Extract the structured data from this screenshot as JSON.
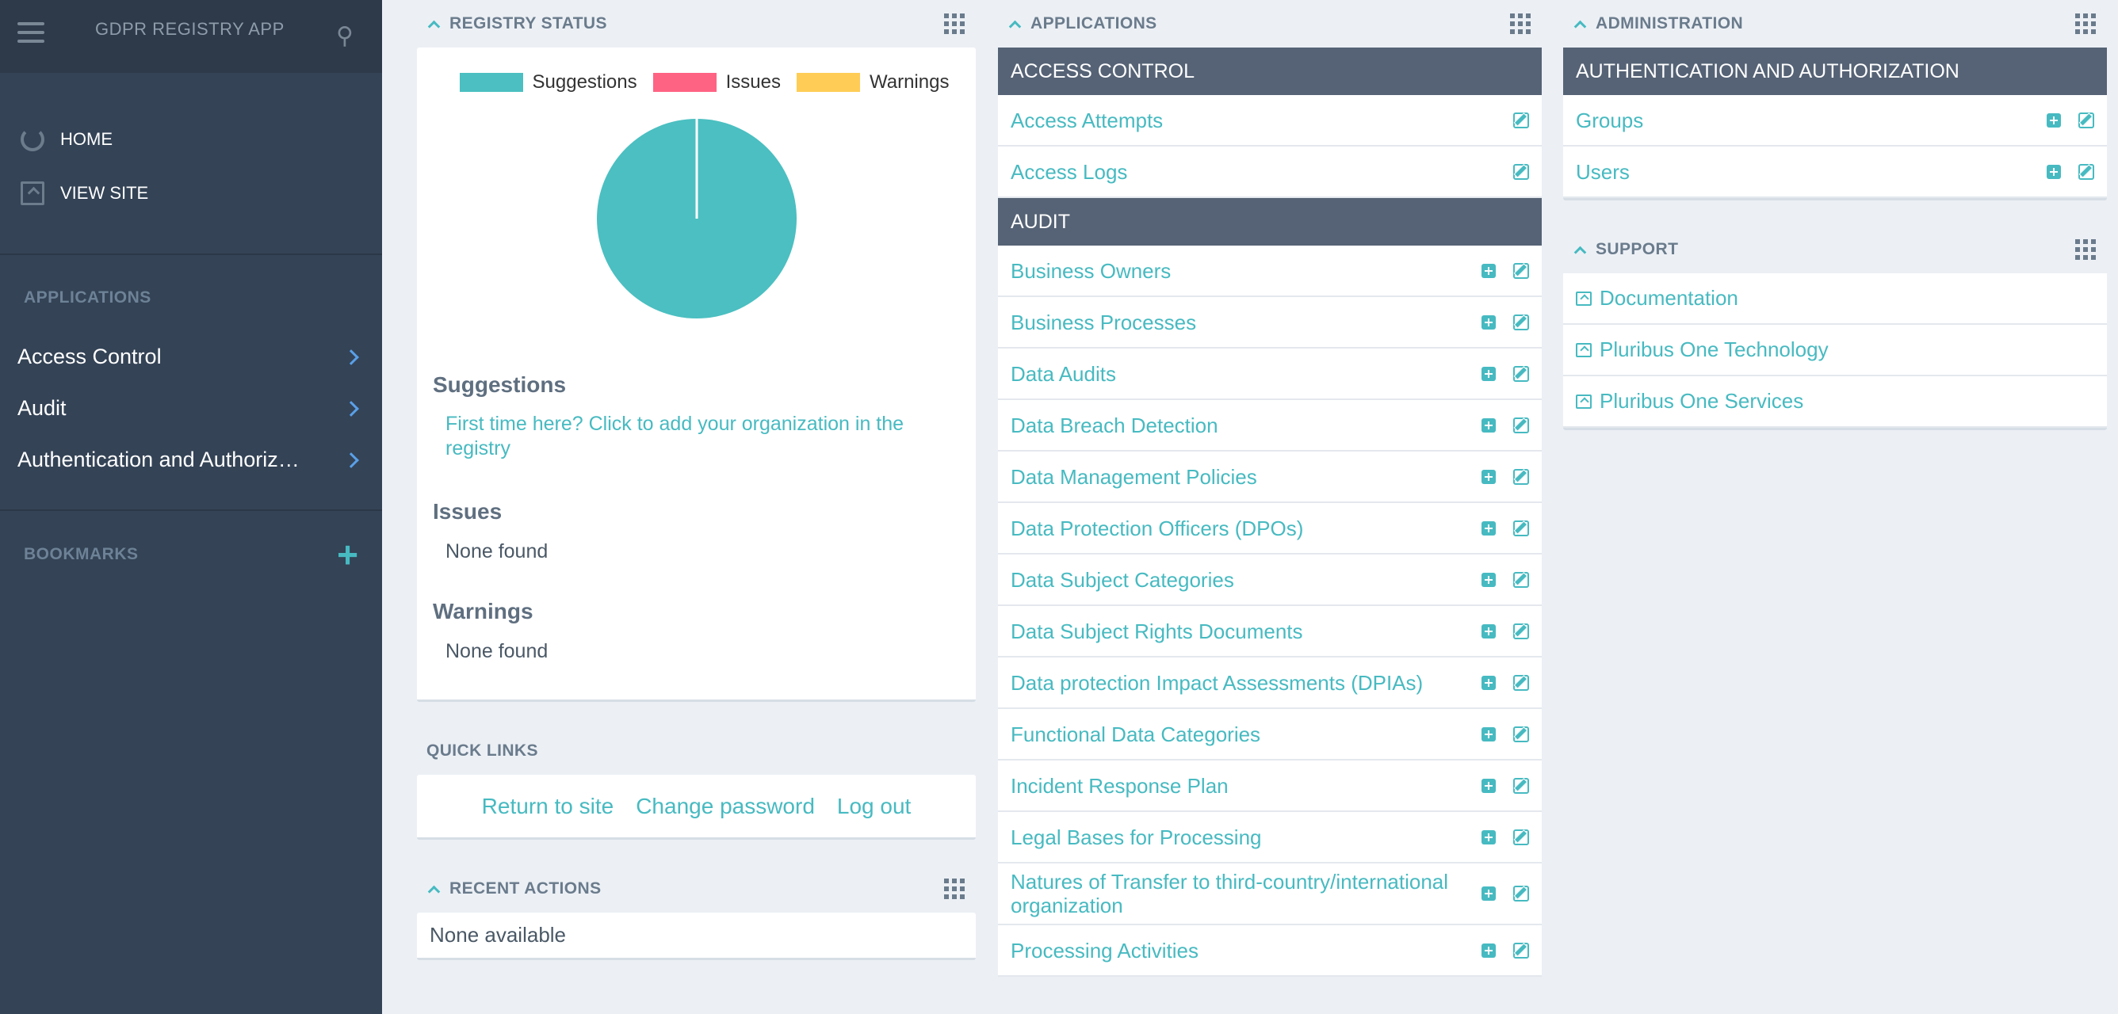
{
  "sidebar": {
    "title": "GDPR REGISTRY APP",
    "nav": [
      {
        "label": "HOME",
        "icon": "refresh-icon"
      },
      {
        "label": "VIEW SITE",
        "icon": "view-site-icon"
      }
    ],
    "applications_title": "APPLICATIONS",
    "apps": [
      "Access Control",
      "Audit",
      "Authentication and Authoriz…"
    ],
    "bookmarks_title": "BOOKMARKS"
  },
  "registry_status": {
    "title": "REGISTRY STATUS",
    "legend": [
      {
        "label": "Suggestions",
        "color": "#4bbfc1"
      },
      {
        "label": "Issues",
        "color": "#ff6384"
      },
      {
        "label": "Warnings",
        "color": "#ffcd56"
      }
    ],
    "suggestions_title": "Suggestions",
    "suggestion_link": "First time here? Click to add your organization in the registry",
    "issues_title": "Issues",
    "issues_text": "None found",
    "warnings_title": "Warnings",
    "warnings_text": "None found"
  },
  "chart_data": {
    "type": "pie",
    "categories": [
      "Suggestions",
      "Issues",
      "Warnings"
    ],
    "values": [
      1,
      0,
      0
    ]
  },
  "quick_links": {
    "title": "QUICK LINKS",
    "links": [
      "Return to site",
      "Change password",
      "Log out"
    ]
  },
  "recent_actions": {
    "title": "RECENT ACTIONS",
    "text": "None available"
  },
  "applications": {
    "title": "APPLICATIONS",
    "groups": [
      {
        "name": "ACCESS CONTROL",
        "rows": [
          {
            "label": "Access Attempts",
            "add": false
          },
          {
            "label": "Access Logs",
            "add": false
          }
        ]
      },
      {
        "name": "AUDIT",
        "rows": [
          {
            "label": "Business Owners",
            "add": true
          },
          {
            "label": "Business Processes",
            "add": true
          },
          {
            "label": "Data Audits",
            "add": true
          },
          {
            "label": "Data Breach Detection",
            "add": true
          },
          {
            "label": "Data Management Policies",
            "add": true
          },
          {
            "label": "Data Protection Officers (DPOs)",
            "add": true
          },
          {
            "label": "Data Subject Categories",
            "add": true
          },
          {
            "label": "Data Subject Rights Documents",
            "add": true
          },
          {
            "label": "Data protection Impact Assessments (DPIAs)",
            "add": true
          },
          {
            "label": "Functional Data Categories",
            "add": true
          },
          {
            "label": "Incident Response Plan",
            "add": true
          },
          {
            "label": "Legal Bases for Processing",
            "add": true
          },
          {
            "label": "Natures of Transfer to third-country/international organization",
            "add": true
          },
          {
            "label": "Processing Activities",
            "add": true
          }
        ]
      }
    ]
  },
  "administration": {
    "title": "ADMINISTRATION",
    "group": "AUTHENTICATION AND AUTHORIZATION",
    "rows": [
      "Groups",
      "Users"
    ]
  },
  "support": {
    "title": "SUPPORT",
    "rows": [
      "Documentation",
      "Pluribus One Technology",
      "Pluribus One Services"
    ]
  }
}
